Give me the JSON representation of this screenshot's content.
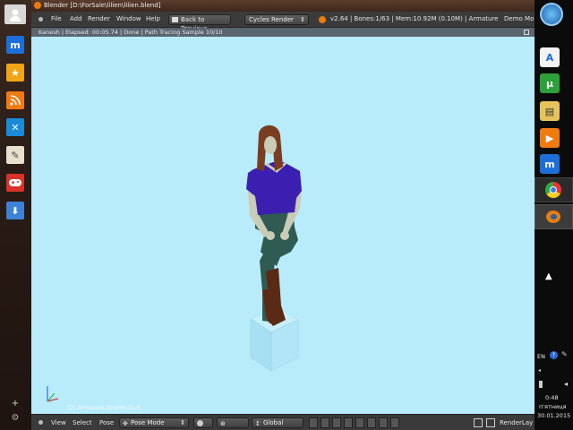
{
  "window": {
    "title": "Blender [D:\\ForSale\\lilien\\lilien.blend]"
  },
  "menu": {
    "file": "File",
    "add": "Add",
    "render": "Render",
    "window": "Window",
    "help": "Help",
    "back_to_previous": "Back to Previous",
    "render_engine": "Cycles Render",
    "stats": "v2.64 | Bones:1/63 | Mem:10.92M (0.10M) | Armature",
    "layout": "Demo Mo"
  },
  "render_status": "Kanesh | Elapsed: 00:05.74 | Done | Path Tracing Sample 10/10",
  "viewport": {
    "object_label": "(2) Armature.thumb.03.R"
  },
  "bottom": {
    "view": "View",
    "select": "Select",
    "pose": "Pose",
    "mode": "Pose Mode",
    "orientation": "Global",
    "render_layer": "RenderLay"
  },
  "taskbar": {
    "language": "EN",
    "time": "0:48",
    "day": "п'ятниця",
    "date": "30.01.2015"
  },
  "colors": {
    "viewport_bg": "#b9ecfb",
    "shirt": "#3a1fb0",
    "hair": "#7a3d22",
    "pants": "#2f5b52",
    "boots": "#5a2a14"
  }
}
